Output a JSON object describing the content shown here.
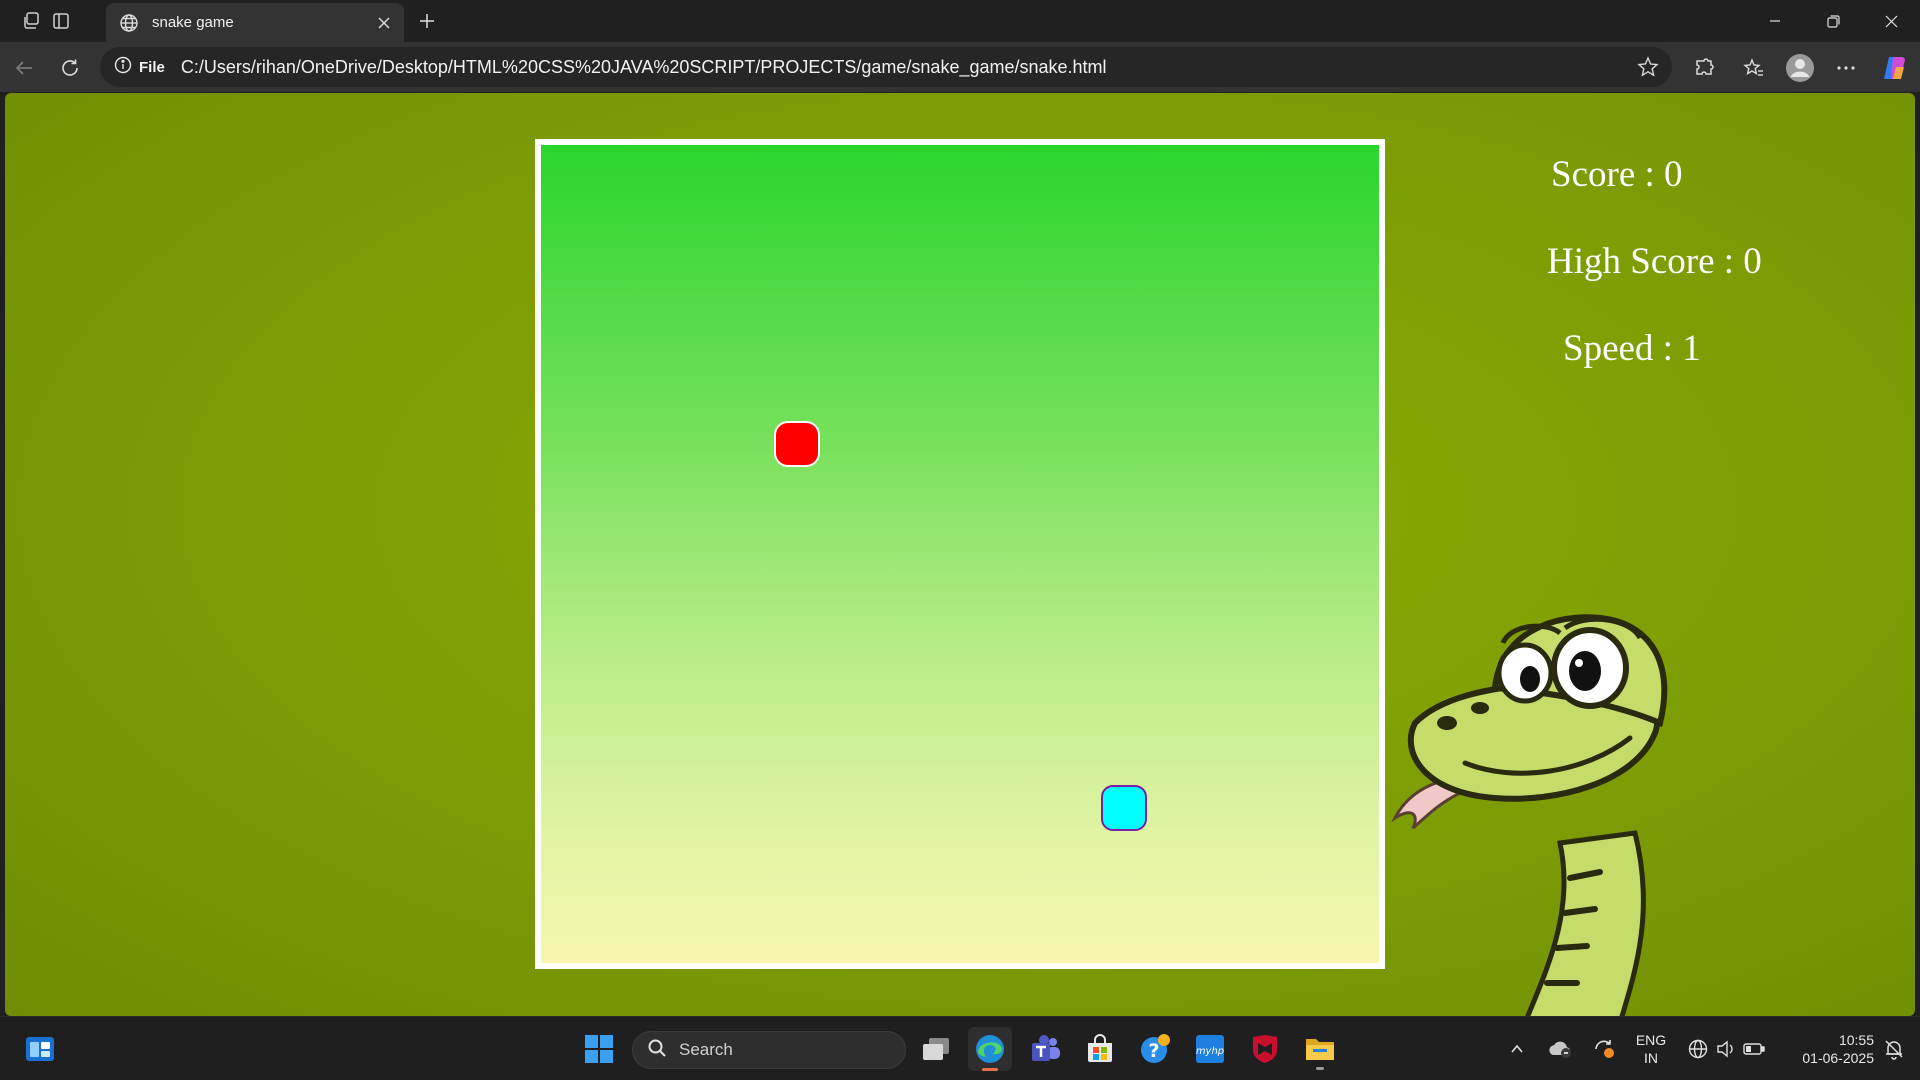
{
  "browser": {
    "tab_title": "snake game",
    "url_chip": "File",
    "url": "C:/Users/rihan/OneDrive/Desktop/HTML%20CSS%20JAVA%20SCRIPT/PROJECTS/game/snake_game/snake.html"
  },
  "game": {
    "score_label": "Score : ",
    "score_value": "0",
    "high_score_label": "High Score : ",
    "high_score_value": "0",
    "speed_label": "Speed : ",
    "speed_value": "1",
    "colors": {
      "food": "#ff0000",
      "snake_head": "#00ffff",
      "board_border": "#ffffff",
      "background": "#7d9c05"
    }
  },
  "taskbar": {
    "search_label": "Search",
    "lang_line1": "ENG",
    "lang_line2": "IN",
    "time": "10:55",
    "date": "01-06-2025"
  },
  "icons": [
    "workspaces-icon",
    "tab-actions-icon",
    "globe-icon",
    "close-icon",
    "plus-icon",
    "minimize-icon",
    "restore-icon",
    "back-icon",
    "refresh-icon",
    "info-icon",
    "star-icon",
    "extensions-icon",
    "favorites-icon",
    "profile-icon",
    "more-icon",
    "copilot-icon",
    "widgets-icon",
    "windows-start-icon",
    "search-icon",
    "task-view-icon",
    "edge-icon",
    "teams-icon",
    "store-icon",
    "help-icon",
    "myhp-icon",
    "mcafee-icon",
    "file-explorer-icon",
    "chevron-up-icon",
    "onedrive-icon",
    "sync-icon",
    "network-icon",
    "volume-icon",
    "battery-icon",
    "notification-icon"
  ]
}
